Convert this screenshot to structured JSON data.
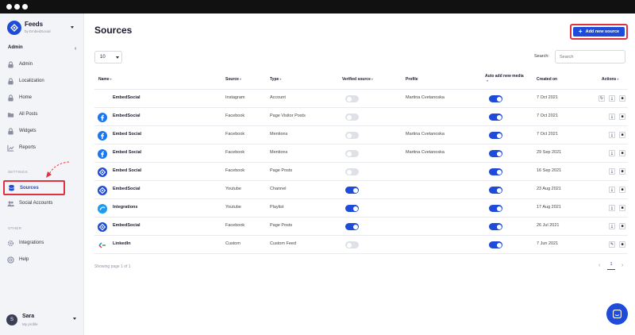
{
  "window": {
    "dots": 3
  },
  "app": {
    "title": "Feeds",
    "subtitle": "by EmbedSocial"
  },
  "sidebar": {
    "section": "Admin",
    "collapse_label": "‹",
    "items_top": [
      {
        "label": "Admin",
        "icon": "lock-icon"
      },
      {
        "label": "Localization",
        "icon": "lock-icon"
      },
      {
        "label": "Home",
        "icon": "lock-icon"
      },
      {
        "label": "All Posts",
        "icon": "folder-icon"
      },
      {
        "label": "Widgets",
        "icon": "lock-icon"
      },
      {
        "label": "Reports",
        "icon": "chart-icon"
      }
    ],
    "settings_label": "SETTINGS",
    "items_settings": [
      {
        "label": "Sources",
        "icon": "database-icon",
        "active": true
      },
      {
        "label": "Social Accounts",
        "icon": "users-icon"
      }
    ],
    "other_label": "OTHER",
    "items_other": [
      {
        "label": "Integrations",
        "icon": "gear-icon"
      },
      {
        "label": "Help",
        "icon": "help-icon"
      }
    ],
    "user": {
      "initial": "S",
      "name": "Sara",
      "sub": "My profile"
    }
  },
  "main": {
    "title": "Sources",
    "add_button": "Add new source",
    "page_size": "10",
    "search_label": "Search:",
    "search_placeholder": "Search",
    "columns": {
      "name": "Name",
      "source": "Source",
      "type": "Type",
      "verified": "Verified source",
      "profile": "Profile",
      "auto_add_1": "Auto add new media",
      "auto_add_2": "",
      "created": "Created on",
      "actions": "Actions"
    },
    "rows": [
      {
        "name": "EmbedSocial",
        "source": "Instagram",
        "type": "Account",
        "verified": false,
        "profile": "Martina Cvetanoska",
        "auto": true,
        "created": "7 Oct 2021",
        "icon": "none",
        "actions": [
          "refresh-icon",
          "download-icon",
          "delete-icon"
        ]
      },
      {
        "name": "EmbedSocial",
        "source": "Facebook",
        "type": "Page Visitor Posts",
        "verified": false,
        "profile": "",
        "auto": true,
        "created": "7 Oct 2021",
        "icon": "facebook-icon",
        "actions": [
          "download-icon",
          "delete-icon"
        ]
      },
      {
        "name": "Embed Social",
        "source": "Facebook",
        "type": "Mentions",
        "verified": false,
        "profile": "Martina Cvetanoska",
        "auto": true,
        "created": "7 Oct 2021",
        "icon": "facebook-icon",
        "actions": [
          "download-icon",
          "delete-icon"
        ]
      },
      {
        "name": "Embed Social",
        "source": "Facebook",
        "type": "Mentions",
        "verified": false,
        "profile": "Martina Cvetanoska",
        "auto": true,
        "created": "29 Sep 2021",
        "icon": "facebook-icon",
        "actions": [
          "download-icon",
          "delete-icon"
        ]
      },
      {
        "name": "Embed Social",
        "source": "Facebook",
        "type": "Page Posts",
        "verified": false,
        "profile": "",
        "auto": true,
        "created": "16 Sep 2021",
        "icon": "embedsocial-icon",
        "actions": [
          "download-icon",
          "delete-icon"
        ]
      },
      {
        "name": "EmbedSocial",
        "source": "Youtube",
        "type": "Channel",
        "verified": true,
        "profile": "",
        "auto": true,
        "created": "23 Aug 2021",
        "icon": "embedsocial-icon",
        "actions": [
          "download-icon",
          "delete-icon"
        ]
      },
      {
        "name": "Integrations",
        "source": "Youtube",
        "type": "Playlist",
        "verified": true,
        "profile": "",
        "auto": true,
        "created": "17 Aug 2021",
        "icon": "integrations-icon",
        "actions": [
          "download-icon",
          "delete-icon"
        ]
      },
      {
        "name": "EmbedSocial",
        "source": "Facebook",
        "type": "Page Posts",
        "verified": true,
        "profile": "",
        "auto": true,
        "created": "26 Jul 2021",
        "icon": "embedsocial-icon",
        "actions": [
          "download-icon",
          "delete-icon"
        ]
      },
      {
        "name": "LinkedIn",
        "source": "Custom",
        "type": "Custom Feed",
        "verified": false,
        "profile": "",
        "auto": true,
        "created": "7 Jun 2021",
        "icon": "custom-icon",
        "actions": [
          "edit-icon",
          "delete-icon"
        ]
      }
    ],
    "footer_info": "Showing page 1 of 1",
    "pagination": {
      "prev": "‹",
      "current": "1",
      "next": "›"
    }
  },
  "colors": {
    "accent": "#1e4bd8",
    "highlight": "#e0323e",
    "facebook": "#1877f2"
  }
}
